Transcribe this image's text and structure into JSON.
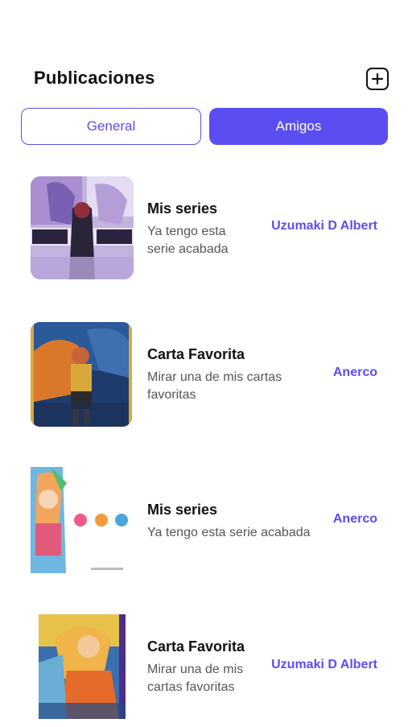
{
  "header": {
    "title": "Publicaciones",
    "add_icon": "plus-square-icon"
  },
  "tabs": [
    {
      "label": "General",
      "active": false
    },
    {
      "label": "Amigos",
      "active": true
    }
  ],
  "posts": [
    {
      "title": "Mis series",
      "description": "Ya tengo esta serie acabada",
      "author": "Uzumaki D Albert"
    },
    {
      "title": "Carta Favorita",
      "description": "Mirar una de mis cartas favoritas",
      "author": "Anerco"
    },
    {
      "title": "Mis series",
      "description": "Ya tengo esta serie acabada",
      "author": "Anerco"
    },
    {
      "title": "Carta Favorita",
      "description": "Mirar una de mis cartas favoritas",
      "author": "Uzumaki D Albert"
    }
  ],
  "colors": {
    "accent": "#5b4ef0"
  }
}
